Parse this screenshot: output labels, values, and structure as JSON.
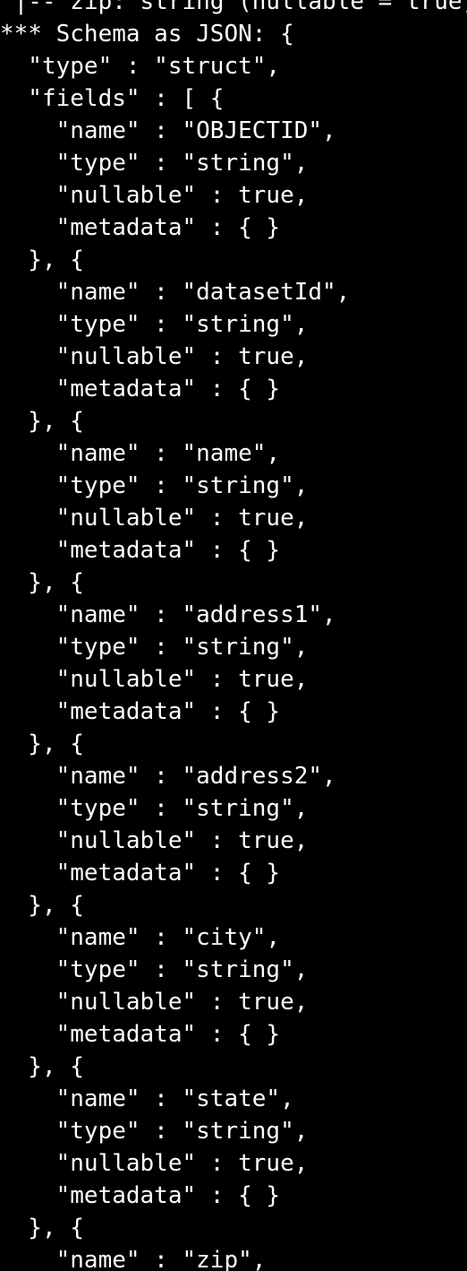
{
  "terminal": {
    "colors": {
      "background": "#000000",
      "foreground": "#ffffff"
    },
    "lines": [
      " |-- zip: string (nullable = true)",
      "*** Schema as JSON: {",
      "  \"type\" : \"struct\",",
      "  \"fields\" : [ {",
      "    \"name\" : \"OBJECTID\",",
      "    \"type\" : \"string\",",
      "    \"nullable\" : true,",
      "    \"metadata\" : { }",
      "  }, {",
      "    \"name\" : \"datasetId\",",
      "    \"type\" : \"string\",",
      "    \"nullable\" : true,",
      "    \"metadata\" : { }",
      "  }, {",
      "    \"name\" : \"name\",",
      "    \"type\" : \"string\",",
      "    \"nullable\" : true,",
      "    \"metadata\" : { }",
      "  }, {",
      "    \"name\" : \"address1\",",
      "    \"type\" : \"string\",",
      "    \"nullable\" : true,",
      "    \"metadata\" : { }",
      "  }, {",
      "    \"name\" : \"address2\",",
      "    \"type\" : \"string\",",
      "    \"nullable\" : true,",
      "    \"metadata\" : { }",
      "  }, {",
      "    \"name\" : \"city\",",
      "    \"type\" : \"string\",",
      "    \"nullable\" : true,",
      "    \"metadata\" : { }",
      "  }, {",
      "    \"name\" : \"state\",",
      "    \"type\" : \"string\",",
      "    \"nullable\" : true,",
      "    \"metadata\" : { }",
      "  }, {",
      "    \"name\" : \"zip\","
    ]
  }
}
